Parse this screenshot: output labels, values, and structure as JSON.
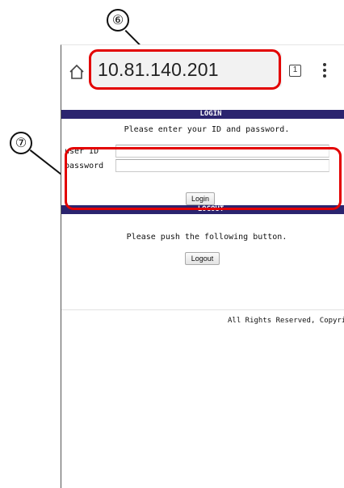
{
  "annotations": {
    "callout_6": "⑥",
    "callout_7": "⑦"
  },
  "browser": {
    "url": "10.81.140.201",
    "tab_count": "1"
  },
  "login": {
    "header": "LOGIN",
    "message": "Please enter your ID and password.",
    "user_id_label": "user ID",
    "password_label": "password",
    "button_label": "Login"
  },
  "logout": {
    "header": "LOGOUT",
    "message": "Please push the following button.",
    "button_label": "Logout"
  },
  "footer": {
    "text": "All Rights Reserved, Copyrig"
  },
  "colors": {
    "header_bg": "#2b246f",
    "annotation_red": "#e30000"
  }
}
